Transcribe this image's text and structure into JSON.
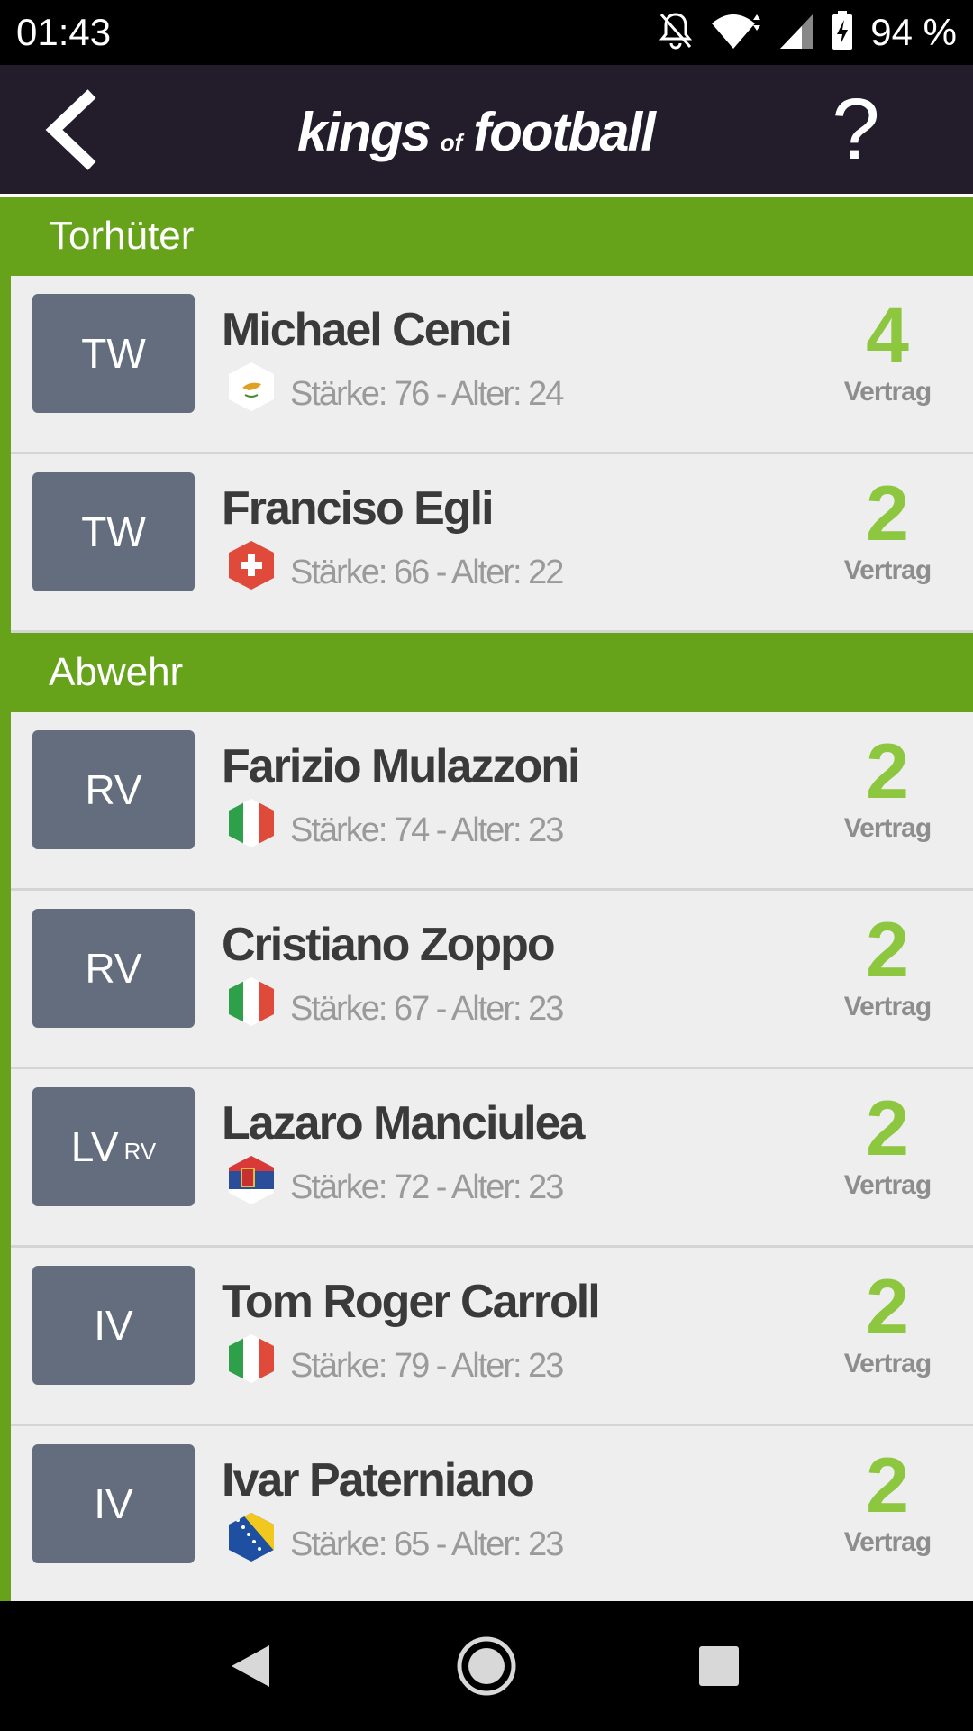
{
  "status": {
    "time": "01:43",
    "battery": "94 %"
  },
  "header": {
    "logo_part1": "kings",
    "logo_part2": "of",
    "logo_part3": "football",
    "help_label": "?"
  },
  "contract_label": "Vertrag",
  "sections": [
    {
      "title": "Torhüter",
      "players": [
        {
          "pos": "TW",
          "pos_secondary": "",
          "name": "Michael Cenci",
          "flag": "cyprus-flag",
          "stats": "Stärke: 76 - Alter: 24",
          "contract": "4"
        },
        {
          "pos": "TW",
          "pos_secondary": "",
          "name": "Franciso Egli",
          "flag": "switzerland-flag",
          "stats": "Stärke: 66 - Alter: 22",
          "contract": "2"
        }
      ]
    },
    {
      "title": "Abwehr",
      "players": [
        {
          "pos": "RV",
          "pos_secondary": "",
          "name": "Farizio Mulazzoni",
          "flag": "italy-flag",
          "stats": "Stärke: 74 - Alter: 23",
          "contract": "2"
        },
        {
          "pos": "RV",
          "pos_secondary": "",
          "name": "Cristiano Zoppo",
          "flag": "italy-flag",
          "stats": "Stärke: 67 - Alter: 23",
          "contract": "2"
        },
        {
          "pos": "LV",
          "pos_secondary": "RV",
          "name": "Lazaro Manciulea",
          "flag": "serbia-flag",
          "stats": "Stärke: 72 - Alter: 23",
          "contract": "2"
        },
        {
          "pos": "IV",
          "pos_secondary": "",
          "name": "Tom Roger Carroll",
          "flag": "italy-flag",
          "stats": "Stärke: 79 - Alter: 23",
          "contract": "2"
        },
        {
          "pos": "IV",
          "pos_secondary": "",
          "name": "Ivar Paterniano",
          "flag": "bosnia-flag",
          "stats": "Stärke: 65 - Alter: 23",
          "contract": "2"
        }
      ]
    }
  ],
  "colors": {
    "accent_green": "#66a31a",
    "contract_green": "#8dc63f",
    "header_bg": "#221c2b",
    "position_box": "#646d7d"
  }
}
